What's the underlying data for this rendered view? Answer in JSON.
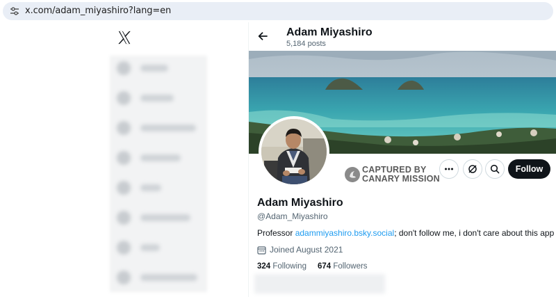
{
  "browser": {
    "url": "x.com/adam_miyashiro?lang=en"
  },
  "header": {
    "name": "Adam Miyashiro",
    "posts": "5,184 posts"
  },
  "watermark": {
    "line1": "CAPTURED BY",
    "line2": "CANARY MISSION"
  },
  "actions": {
    "follow_label": "Follow"
  },
  "profile": {
    "name": "Adam Miyashiro",
    "handle": "@Adam_Miyashiro",
    "bio_prefix": "Professor ",
    "bio_link": "adammiyashiro.bsky.social",
    "bio_suffix": "; don't follow me, i don't care about this app",
    "joined": "Joined August 2021",
    "following_count": "324",
    "following_label": " Following",
    "followers_count": "674",
    "followers_label": " Followers"
  },
  "colors": {
    "accent": "#1d9bf0",
    "text": "#0f1419",
    "muted": "#536471"
  }
}
